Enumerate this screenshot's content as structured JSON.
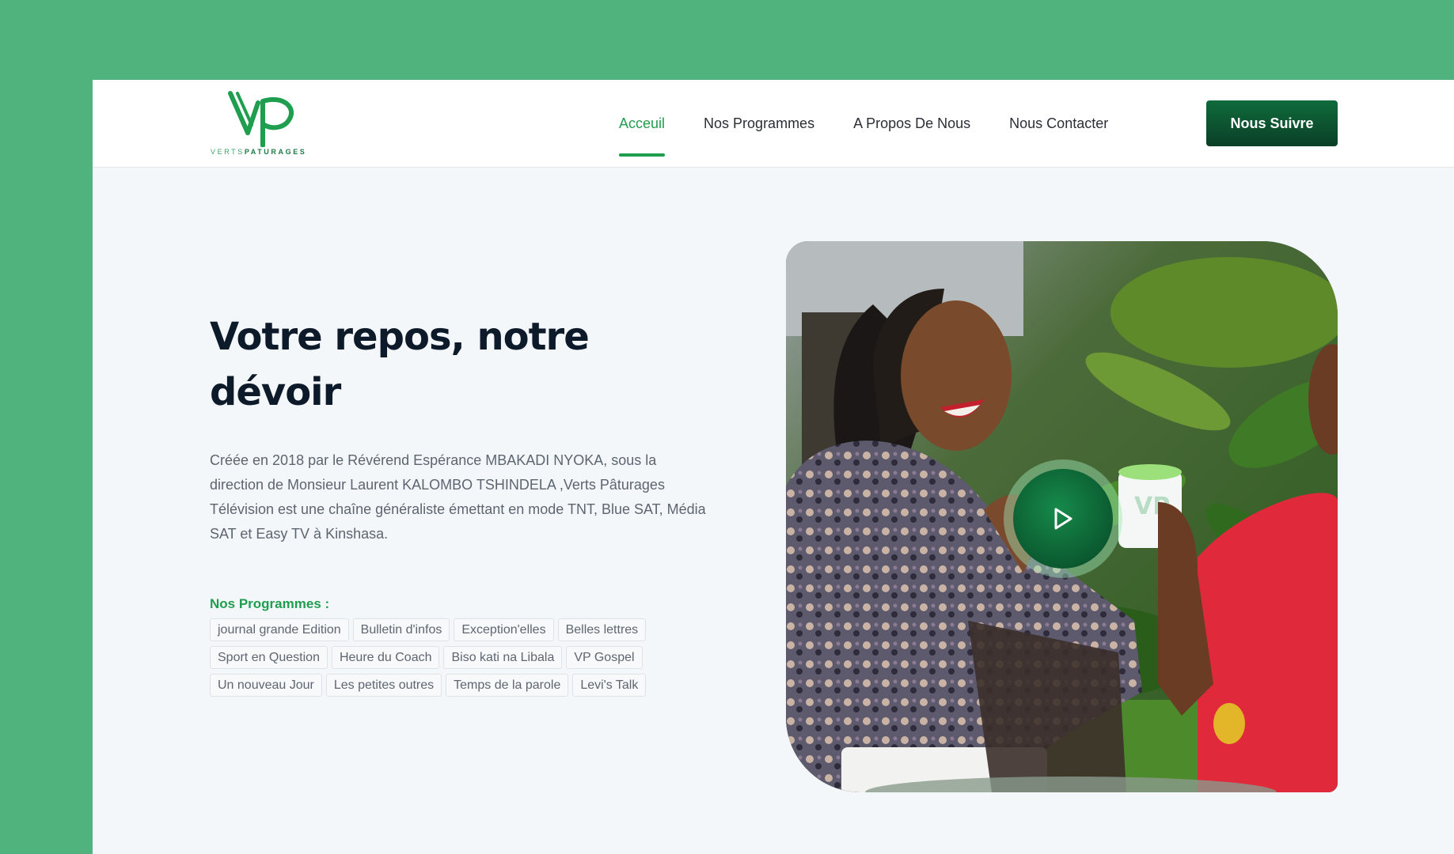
{
  "brand": {
    "logo_mark": "VP",
    "logo_text_light": "VERTS",
    "logo_text_bold": "PATURAGES"
  },
  "nav": {
    "items": [
      {
        "label": "Acceuil",
        "active": true
      },
      {
        "label": "Nos Programmes",
        "active": false
      },
      {
        "label": "A Propos De Nous",
        "active": false
      },
      {
        "label": "Nous Contacter",
        "active": false
      }
    ],
    "cta_label": "Nous Suivre"
  },
  "hero": {
    "title": "Votre repos, notre dévoir",
    "description": "Créée en 2018 par le Révérend Espérance MBAKADI NYOKA, sous la direction de Monsieur Laurent KALOMBO TSHINDELA ,Verts Pâturages Télévision est une chaîne généraliste émettant en mode TNT, Blue SAT, Média SAT et Easy TV à Kinshasa.",
    "programs_heading": "Nos Programmes :",
    "programs": [
      "journal grande Edition",
      "Bulletin d'infos",
      "Exception'elles",
      "Belles lettres",
      "Sport en Question",
      "Heure du Coach",
      "Biso kati na Libala",
      "VP Gospel",
      "Un nouveau Jour",
      "Les petites outres",
      "Temps de la parole",
      "Levi's Talk"
    ],
    "media_icon": "play-icon"
  },
  "colors": {
    "page_background": "#50b27c",
    "accent": "#1f9e4f",
    "button_dark": "#0b4a2a",
    "title": "#0d1a2a"
  }
}
